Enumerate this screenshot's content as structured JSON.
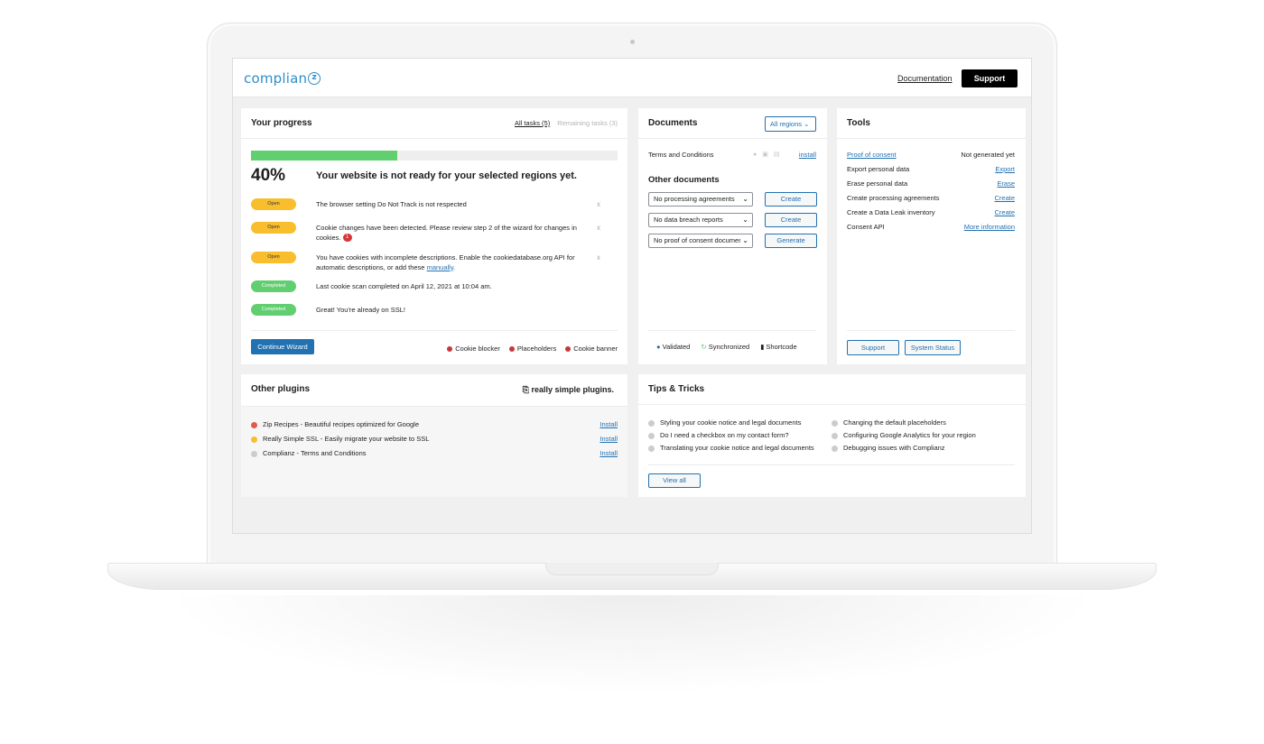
{
  "header": {
    "logo_text": "complian",
    "logo_mark": "z",
    "documentation_label": "Documentation",
    "support_label": "Support"
  },
  "progress": {
    "title": "Your progress",
    "tab_all": "All tasks (5)",
    "tab_remaining": "Remaining tasks (3)",
    "percent_value": 0.4,
    "percent_label": "40%",
    "headline": "Your website is not ready for your selected regions yet.",
    "tasks": [
      {
        "status": "Open",
        "text_1": "The browser setting Do Not Track is not respected",
        "text_2": "",
        "link": "",
        "tail": ""
      },
      {
        "status": "Open",
        "text_1": "Cookie changes have been detected. Please review step 2 of the wizard for changes in cookies.",
        "badge": "1"
      },
      {
        "status": "Open",
        "text_1": "You have cookies with incomplete descriptions. Enable the cookiedatabase.org API for automatic descriptions, or add these ",
        "link": "manually",
        "tail": "."
      },
      {
        "status": "Completed",
        "text_1": "Last cookie scan completed on April 12, 2021 at 10:04 am."
      },
      {
        "status": "Completed",
        "text_1": "Great! You're already on SSL!"
      }
    ],
    "dismiss_glyph": "x",
    "continue_label": "Continue Wizard",
    "legend": [
      "Cookie blocker",
      "Placeholders",
      "Cookie banner"
    ]
  },
  "documents": {
    "title": "Documents",
    "region_select": "All regions",
    "terms_label": "Terms and Conditions",
    "terms_action": "install",
    "other_title": "Other documents",
    "rows": [
      {
        "select": "No processing agreements",
        "button": "Create"
      },
      {
        "select": "No data breach reports",
        "button": "Create"
      },
      {
        "select": "No proof of consent documents",
        "button": "Generate"
      }
    ],
    "legend": [
      "Validated",
      "Synchronized",
      "Shortcode"
    ]
  },
  "tools": {
    "title": "Tools",
    "rows": [
      {
        "label": "Proof of consent",
        "value": "Not generated yet",
        "label_is_link": true,
        "value_is_link": false
      },
      {
        "label": "Export personal data",
        "value": "Export",
        "label_is_link": false,
        "value_is_link": true
      },
      {
        "label": "Erase personal data",
        "value": "Erase",
        "label_is_link": false,
        "value_is_link": true
      },
      {
        "label": "Create processing agreements",
        "value": "Create",
        "label_is_link": false,
        "value_is_link": true
      },
      {
        "label": "Create a Data Leak inventory",
        "value": "Create",
        "label_is_link": false,
        "value_is_link": true
      },
      {
        "label": "Consent API",
        "value": "More information",
        "label_is_link": false,
        "value_is_link": true
      }
    ],
    "support_label": "Support",
    "system_status_label": "System Status"
  },
  "plugins": {
    "title": "Other plugins",
    "brand": "really simple plugins.",
    "items": [
      {
        "name": "Zip Recipes - Beautiful recipes optimized for Google",
        "action": "Install",
        "color": "#e05c4a"
      },
      {
        "name": "Really Simple SSL - Easily migrate your website to SSL",
        "action": "Install",
        "color": "#f8be2e"
      },
      {
        "name": "Complianz - Terms and Conditions",
        "action": "Install",
        "color": "#cccccc"
      }
    ]
  },
  "tips": {
    "title": "Tips & Tricks",
    "items": [
      "Styling your cookie notice and legal documents",
      "Do I need a checkbox on my contact form?",
      "Translating your cookie notice and legal documents",
      "Changing the default placeholders",
      "Configuring Google Analytics for your region",
      "Debugging issues with Complianz"
    ],
    "view_all": "View all"
  },
  "colors": {
    "accent": "#2271b1",
    "open": "#f8be2e",
    "completed": "#61ce70",
    "error": "#d63638"
  }
}
